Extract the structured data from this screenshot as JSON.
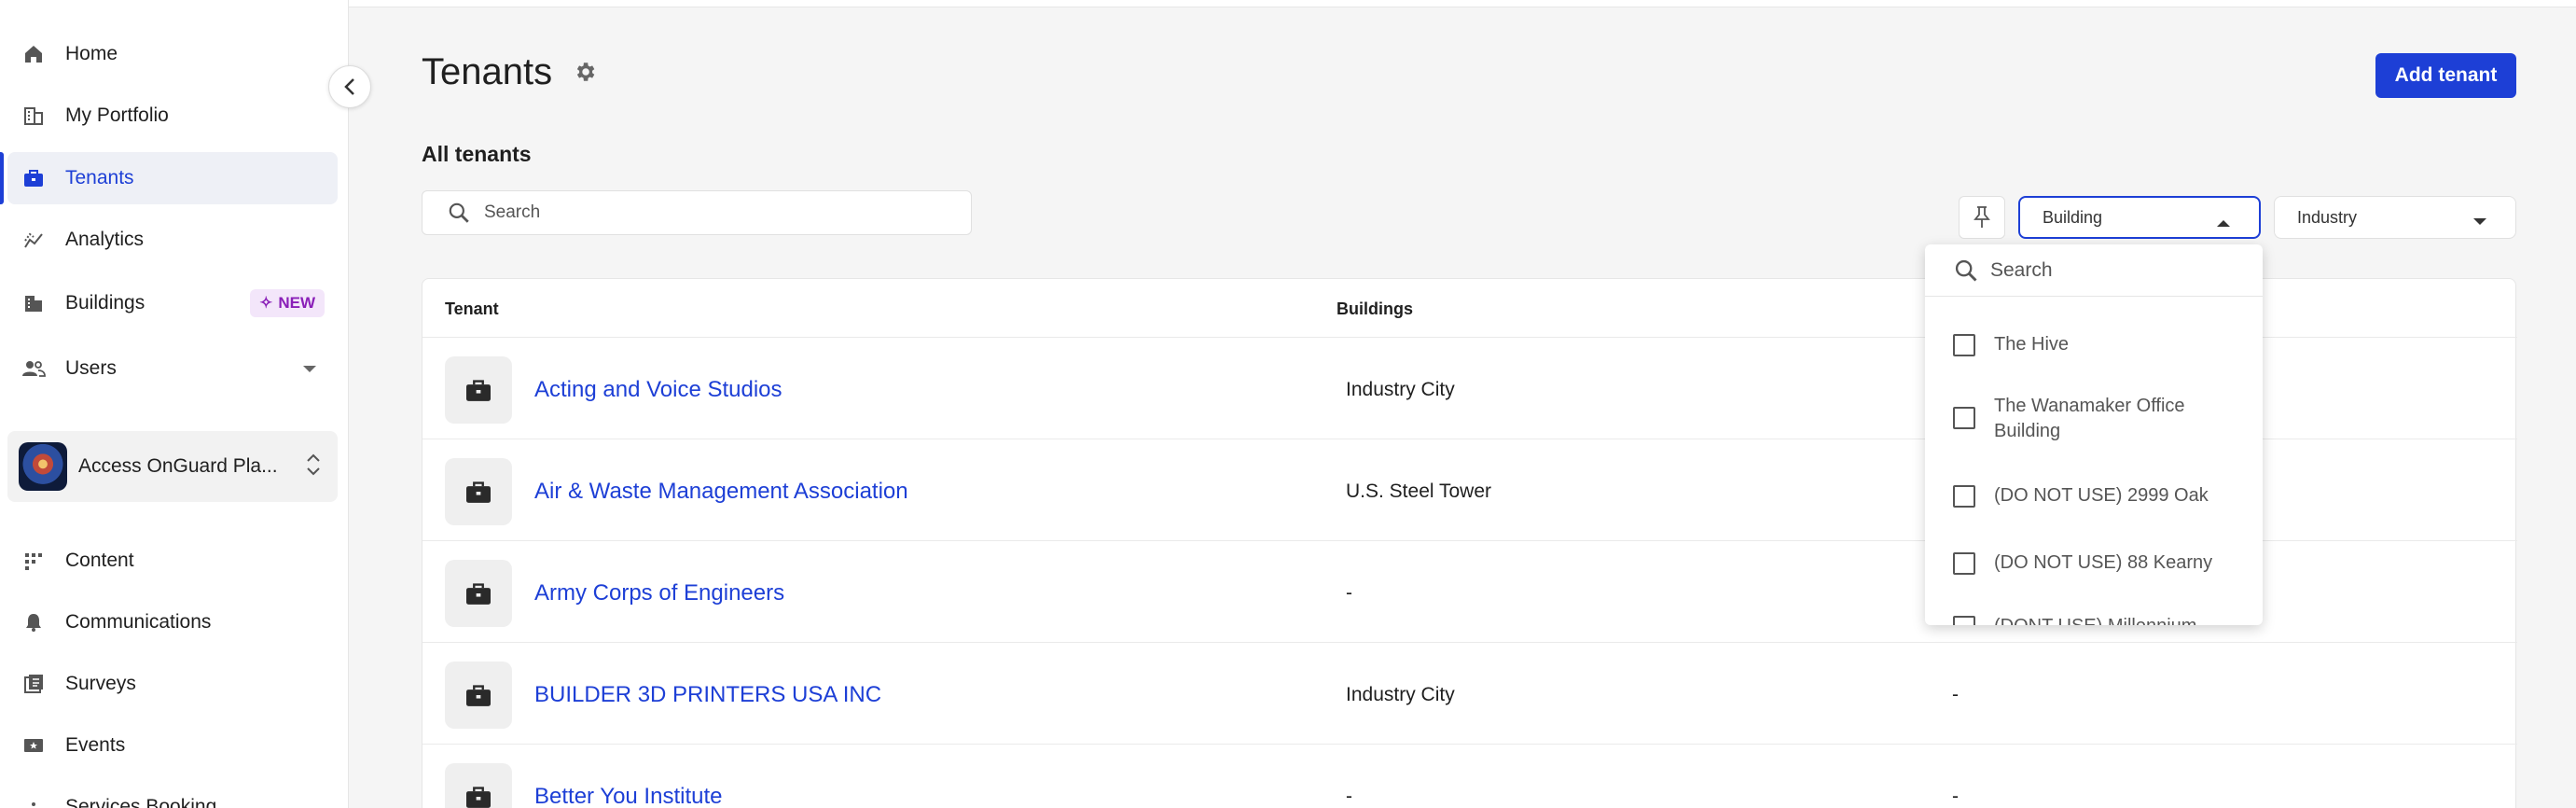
{
  "sidebar": {
    "items": [
      {
        "label": "Home",
        "icon": "home-icon"
      },
      {
        "label": "My Portfolio",
        "icon": "portfolio-icon"
      },
      {
        "label": "Tenants",
        "icon": "briefcase-icon",
        "active": true
      },
      {
        "label": "Analytics",
        "icon": "analytics-icon"
      },
      {
        "label": "Buildings",
        "icon": "building-icon",
        "badge": "NEW"
      },
      {
        "label": "Users",
        "icon": "users-icon"
      }
    ],
    "org_name": "Access OnGuard Pla...",
    "secondary_items": [
      {
        "label": "Content",
        "icon": "content-icon"
      },
      {
        "label": "Communications",
        "icon": "bell-icon"
      },
      {
        "label": "Surveys",
        "icon": "survey-icon"
      },
      {
        "label": "Events",
        "icon": "events-icon"
      },
      {
        "label": "Services Booking",
        "icon": "services-icon"
      }
    ]
  },
  "header": {
    "title": "Tenants",
    "add_button": "Add tenant"
  },
  "section_label": "All tenants",
  "search": {
    "placeholder": "Search"
  },
  "filters": {
    "building": "Building",
    "industry": "Industry"
  },
  "table": {
    "columns": [
      "Tenant",
      "Buildings"
    ],
    "rows": [
      {
        "tenant": "Acting and Voice Studios",
        "building": "Industry City",
        "industry": ""
      },
      {
        "tenant": "Air & Waste Management Association",
        "building": "U.S. Steel Tower",
        "industry": ""
      },
      {
        "tenant": "Army Corps of Engineers",
        "building": "-",
        "industry": ""
      },
      {
        "tenant": "BUILDER 3D PRINTERS USA INC",
        "building": "Industry City",
        "industry": "-"
      },
      {
        "tenant": "Better You Institute",
        "building": "-",
        "industry": "-"
      }
    ]
  },
  "building_dropdown": {
    "search_placeholder": "Search",
    "options": [
      "The Hive",
      "The Wanamaker Office Building",
      "(DO NOT USE) 2999 Oak",
      "(DO NOT USE) 88 Kearny",
      "(DONT USE) Millennium"
    ]
  },
  "colors": {
    "accent": "#1d3fd6",
    "badge_bg": "#f3e6fa",
    "badge_text": "#8a1fb8"
  }
}
